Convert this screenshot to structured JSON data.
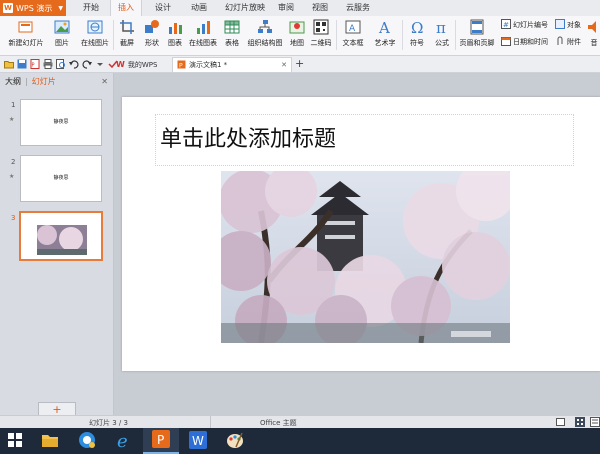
{
  "app": {
    "name": "WPS 演示"
  },
  "menu": {
    "tabs": [
      "开始",
      "插入",
      "设计",
      "动画",
      "幻灯片放映",
      "审阅",
      "视图",
      "云服务"
    ],
    "active": "插入"
  },
  "ribbon": {
    "items": [
      "新建幻灯片",
      "图片",
      "在线图片",
      "截屏",
      "形状",
      "图表",
      "在线图表",
      "表格",
      "组织结构图",
      "地图",
      "二维码",
      "文本框",
      "艺术字",
      "符号",
      "公式",
      "页眉和页脚"
    ],
    "right_items": [
      "幻灯片编号",
      "对象",
      "日期和时间",
      "附件"
    ],
    "edge_item": "音"
  },
  "doc_tabs": {
    "tab1": "我的WPS",
    "tab2": "演示文稿1 *"
  },
  "left_pane": {
    "tabs": [
      "大纲",
      "幻灯片"
    ],
    "slides": [
      {
        "number": "1",
        "thumb_text": "静夜思"
      },
      {
        "number": "2",
        "thumb_text": "静夜思"
      },
      {
        "number": "3",
        "thumb_text": ""
      }
    ],
    "add_label": "+"
  },
  "slide": {
    "title_placeholder": "单击此处添加标题"
  },
  "status": {
    "slide_counter": "幻灯片 3 / 3",
    "theme": "Office 主题"
  },
  "colors": {
    "accent": "#e56a1c",
    "taskbar": "#1e2a3a"
  }
}
